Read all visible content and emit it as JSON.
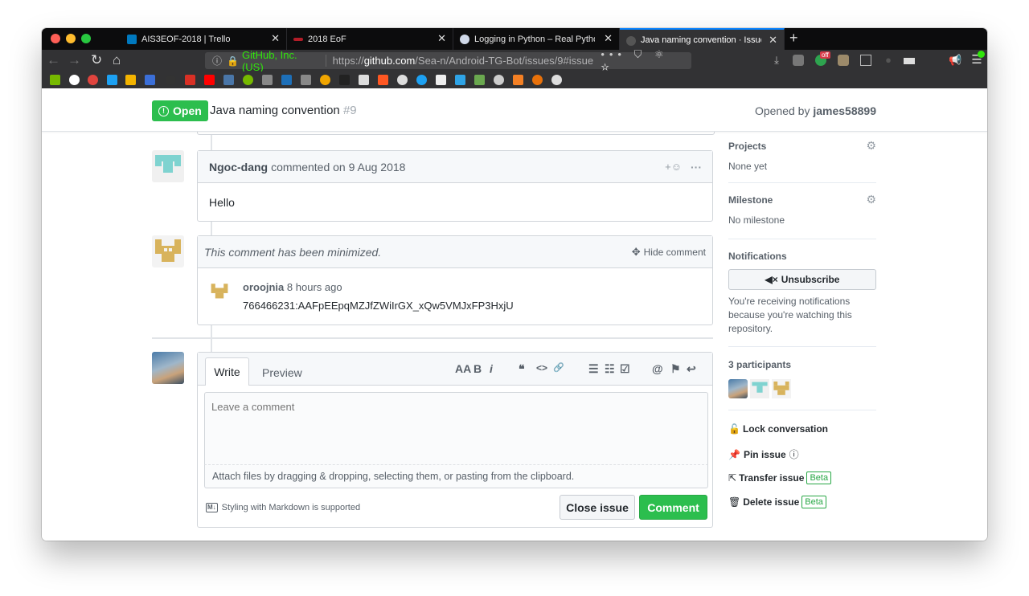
{
  "browser": {
    "tabs": [
      {
        "title": "AIS3EOF-2018 | Trello",
        "favicon_color": "#0079bf"
      },
      {
        "title": "2018 EoF",
        "favicon_color": "#b31d28"
      },
      {
        "title": "Logging in Python – Real Pytho",
        "favicon_color": "#cfd8e8"
      },
      {
        "title": "Java naming convention · Issue",
        "favicon_color": "#555555"
      }
    ],
    "new_tab": "+",
    "close_glyph": "✕",
    "site_identity": "GitHub, Inc. (US)",
    "url_prefix": "https://",
    "url_domain": "github.com",
    "url_path": "/Sea-n/Android-TG-Bot/issues/9#issue",
    "url_icons": "••• ⛉ ⚛ ☆",
    "nav": {
      "back": "←",
      "forward": "→",
      "reload": "↻",
      "home": "⌂"
    },
    "badge_off": "off"
  },
  "issue": {
    "state": "Open",
    "title": "Java naming convention",
    "number": "#9",
    "opened_by_prefix": "Opened by",
    "opened_by_user": "james58899"
  },
  "comments": [
    {
      "author": "Ngoc-dang",
      "action": "commented on 9 Aug 2018",
      "body": "Hello",
      "reaction_icon": "+☺",
      "more_icon": "···"
    }
  ],
  "minimized_comment": {
    "notice": "This comment has been minimized.",
    "hide_label": "Hide comment",
    "author": "oroojnia",
    "time": "8 hours ago",
    "body": "766466231:AAFpEEpqMZJfZWiIrGX_xQw5VMJxFP3HxjU"
  },
  "editor": {
    "tab_write": "Write",
    "tab_preview": "Preview",
    "toolbar": [
      "AA",
      "B",
      "i",
      "❝",
      "<>",
      "🔗",
      "☰",
      "☷",
      "☑",
      "@",
      "⚑",
      "↩"
    ],
    "placeholder": "Leave a comment",
    "attach_hint": "Attach files by dragging & dropping, selecting them, or pasting from the clipboard.",
    "markdown_badge": "M↓",
    "markdown_note": "Styling with Markdown is supported",
    "close_button": "Close issue",
    "comment_button": "Comment"
  },
  "sidebar": {
    "projects": {
      "heading": "Projects",
      "value": "None yet"
    },
    "milestone": {
      "heading": "Milestone",
      "value": "No milestone"
    },
    "notifications": {
      "heading": "Notifications",
      "button": "Unsubscribe",
      "description": "You're receiving notifications because you're watching this repository."
    },
    "participants": {
      "heading": "3 participants"
    },
    "actions": {
      "lock": "Lock conversation",
      "pin": "Pin issue",
      "transfer": "Transfer issue",
      "delete": "Delete issue",
      "beta": "Beta"
    }
  },
  "colors": {
    "open_green": "#2cbe4e",
    "comment_green": "#28a745",
    "teal_identicon": "#7fd3d0",
    "gold_identicon": "#d8b35c"
  }
}
